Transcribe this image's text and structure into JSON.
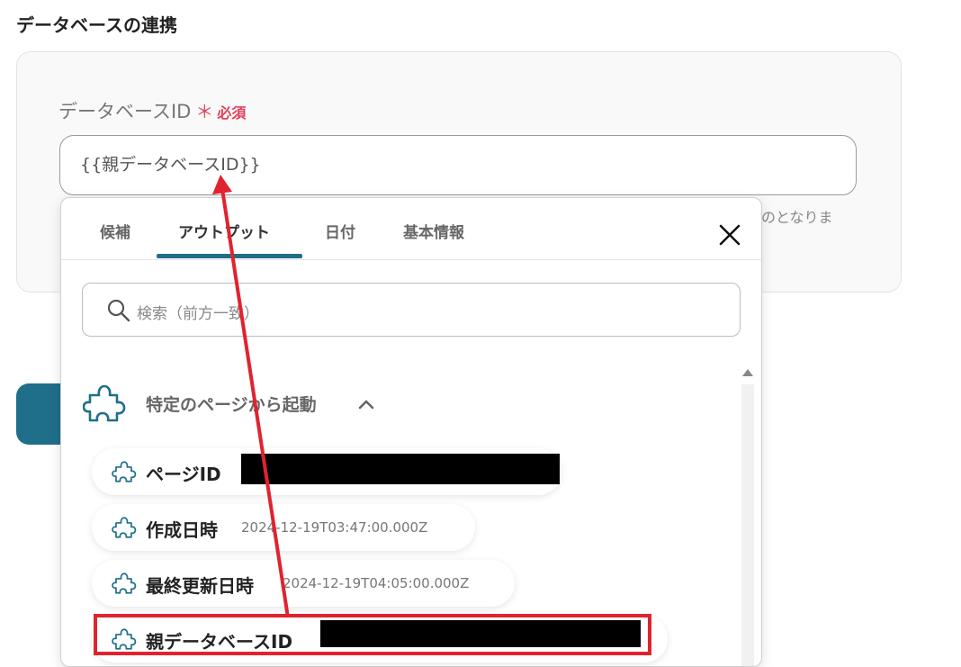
{
  "section": {
    "title": "データベースの連携"
  },
  "field": {
    "label": "データベースID",
    "asterisk": "＊",
    "required": "必須",
    "value": "{{親データベースID}}",
    "help_text": "のとなりま"
  },
  "popup": {
    "tabs": [
      {
        "label": "候補",
        "active": false
      },
      {
        "label": "アウトプット",
        "active": true
      },
      {
        "label": "日付",
        "active": false
      },
      {
        "label": "基本情報",
        "active": false
      }
    ],
    "search_placeholder": "検索（前方一致）",
    "group": {
      "label": "特定のページから起動",
      "expanded": true
    },
    "items": [
      {
        "label": "ページID",
        "value": "",
        "redacted": true
      },
      {
        "label": "作成日時",
        "value": "2024-12-19T03:47:00.000Z",
        "redacted": false
      },
      {
        "label": "最終更新日時",
        "value": "2024-12-19T04:05:00.000Z",
        "redacted": false
      },
      {
        "label": "親データベースID",
        "value": "",
        "redacted": true,
        "highlighted": true
      }
    ]
  },
  "colors": {
    "accent": "#1f6f8a",
    "required": "#e0425a",
    "annotation": "#e0232e"
  }
}
